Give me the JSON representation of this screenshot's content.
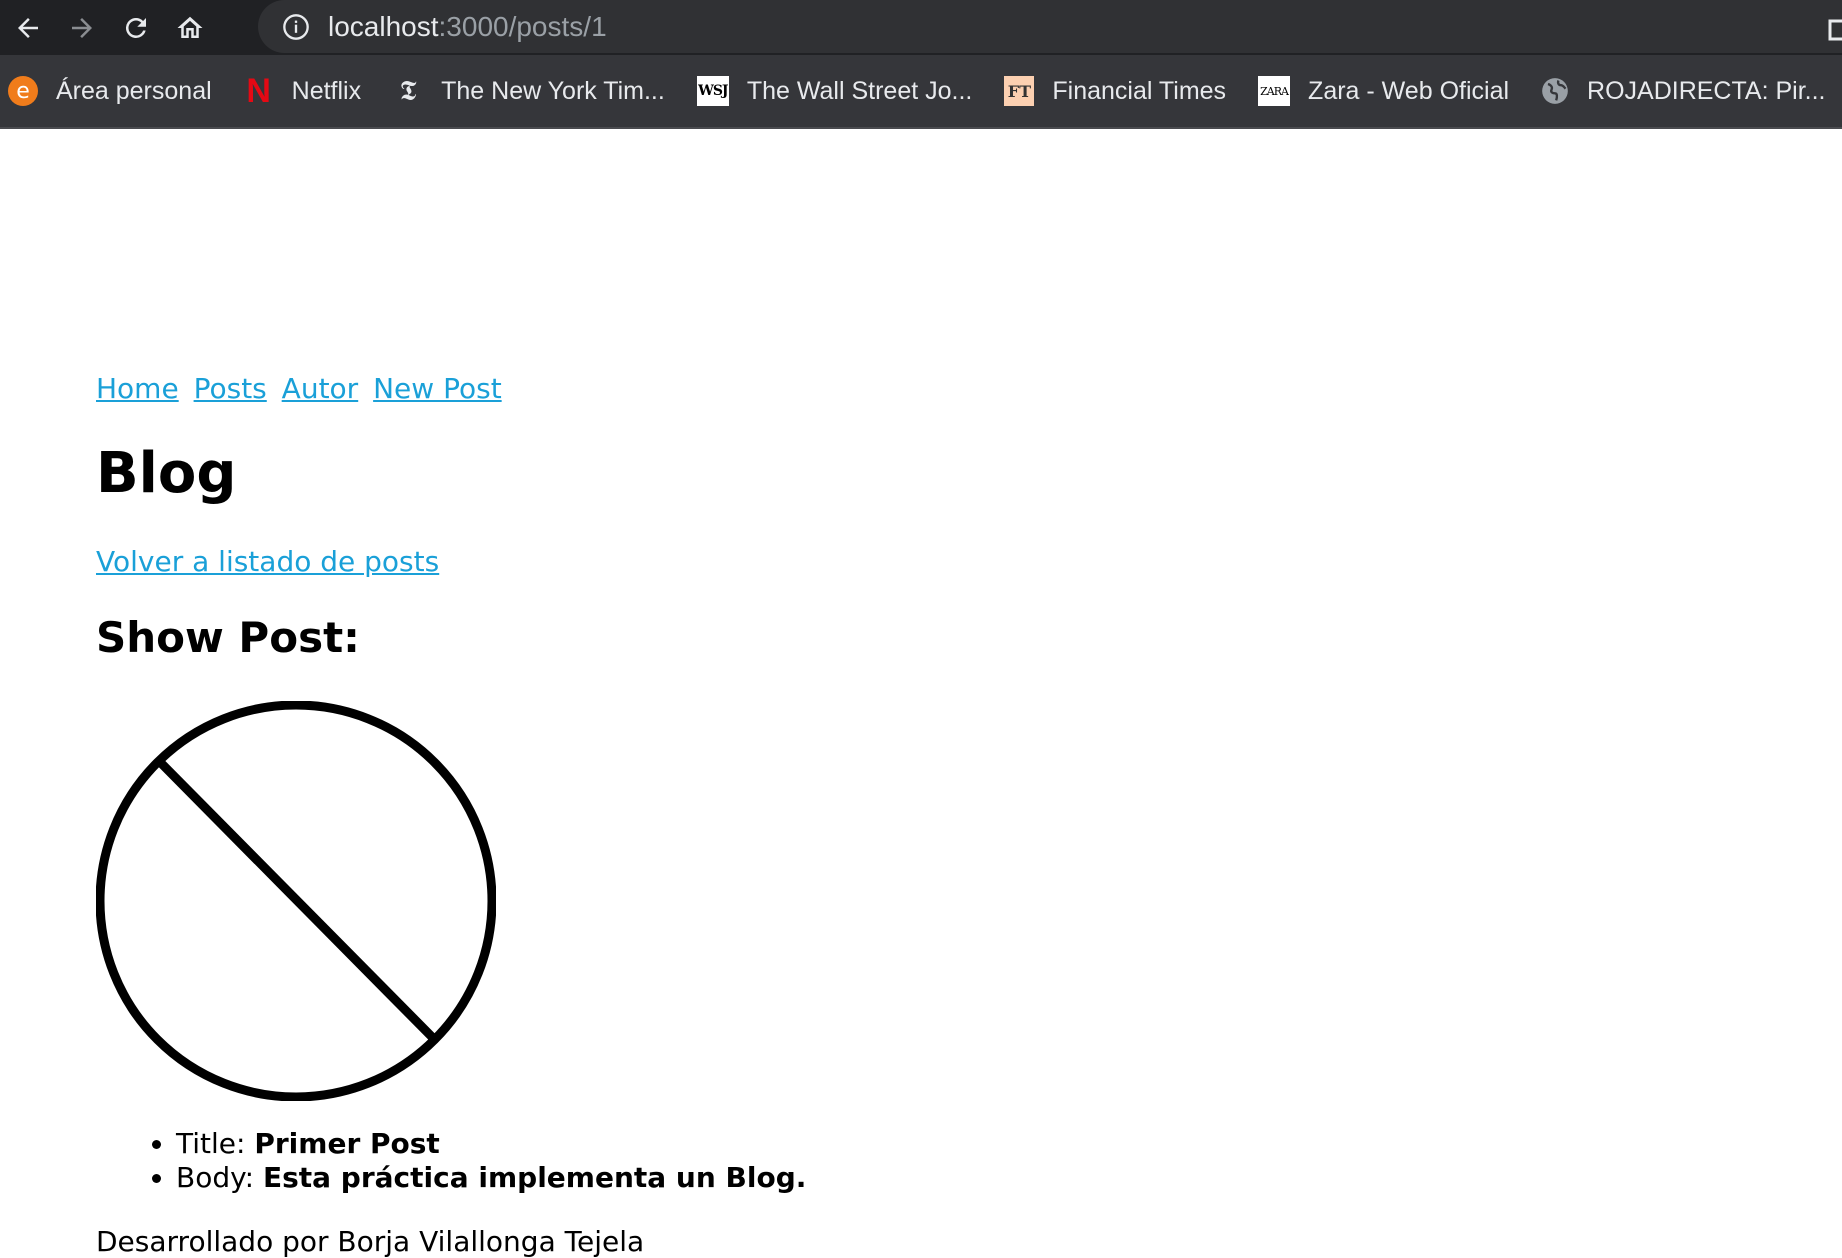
{
  "browser": {
    "url_host": "localhost",
    "url_rest": ":3000/posts/1",
    "bookmarks": [
      {
        "label": "Área personal",
        "icon": "e-orange-circle-icon"
      },
      {
        "label": "Netflix",
        "icon": "netflix-n-icon"
      },
      {
        "label": "The New York Tim...",
        "icon": "nyt-t-icon"
      },
      {
        "label": "The Wall Street Jo...",
        "icon": "wsj-icon"
      },
      {
        "label": "Financial Times",
        "icon": "ft-icon"
      },
      {
        "label": "Zara - Web Oficial",
        "icon": "zara-icon"
      },
      {
        "label": "ROJADIRECTA: Pir...",
        "icon": "globe-icon"
      }
    ],
    "favicon_text": {
      "e": "e",
      "n": "N",
      "t": "𝕿",
      "wsj": "WSJ",
      "ft": "FT",
      "zara": "ZARA"
    }
  },
  "nav": {
    "home": "Home",
    "posts": "Posts",
    "autor": "Autor",
    "new_post": "New Post"
  },
  "page": {
    "title": "Blog",
    "back_link": "Volver a listado de posts",
    "heading": "Show Post:",
    "fields": {
      "title_label": "Title: ",
      "title_value": "Primer Post",
      "body_label": "Body: ",
      "body_value": "Esta práctica implementa un Blog."
    },
    "footer": "Desarrollado por Borja Vilallonga Tejela"
  },
  "colors": {
    "link": "#1aa0d8",
    "chrome_bg": "#202124",
    "bookmarks_bg": "#35363a"
  }
}
